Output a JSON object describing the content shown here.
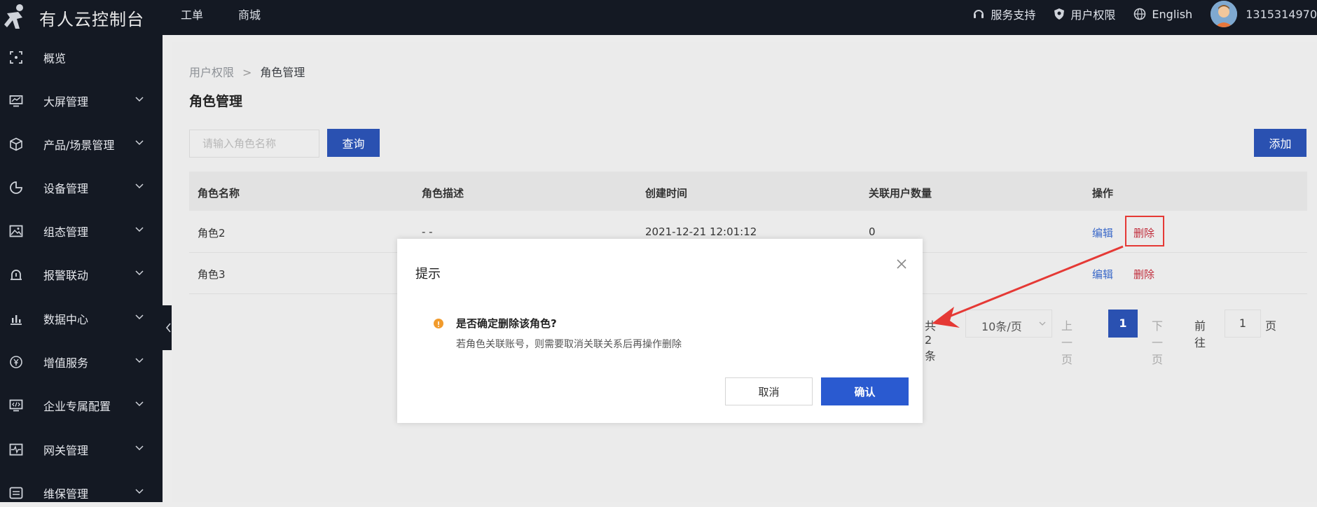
{
  "header": {
    "logo_text": "有人云控制台",
    "nav": [
      "工单",
      "商城"
    ],
    "service": "服务支持",
    "permission": "用户权限",
    "language": "English",
    "user_id": "1315314970"
  },
  "sidebar": {
    "items": [
      {
        "label": "概览",
        "icon": "overview-icon"
      },
      {
        "label": "大屏管理",
        "icon": "screen-icon"
      },
      {
        "label": "产品/场景管理",
        "icon": "cube-icon"
      },
      {
        "label": "设备管理",
        "icon": "pie-icon"
      },
      {
        "label": "组态管理",
        "icon": "image-icon"
      },
      {
        "label": "报警联动",
        "icon": "alarm-icon"
      },
      {
        "label": "数据中心",
        "icon": "bar-icon"
      },
      {
        "label": "增值服务",
        "icon": "yen-icon"
      },
      {
        "label": "企业专属配置",
        "icon": "code-screen-icon"
      },
      {
        "label": "网关管理",
        "icon": "pulse-icon"
      },
      {
        "label": "维保管理",
        "icon": "list-icon"
      }
    ]
  },
  "breadcrumb": {
    "parent": "用户权限",
    "sep": ">",
    "current": "角色管理"
  },
  "page_title": "角色管理",
  "search": {
    "placeholder": "请输入角色名称",
    "button": "查询"
  },
  "add_button": "添加",
  "table": {
    "columns": [
      "角色名称",
      "角色描述",
      "创建时间",
      "关联用户数量",
      "操作"
    ],
    "rows": [
      {
        "name": "角色2",
        "desc": "- -",
        "created": "2021-12-21 12:01:12",
        "users": "0",
        "edit": "编辑",
        "delete": "删除"
      },
      {
        "name": "角色3",
        "edit": "编辑",
        "delete": "删除"
      }
    ]
  },
  "pager": {
    "total": "共 2 条",
    "size": "10条/页",
    "prev": "上一页",
    "page": "1",
    "next": "下一页",
    "goto": "前往",
    "goto_value": "1",
    "page_unit": "页"
  },
  "dialog": {
    "title": "提示",
    "heading": "是否确定删除该角色?",
    "message": "若角色关联账号，则需要取消关联关系后再操作删除",
    "cancel": "取消",
    "confirm": "确认"
  },
  "colors": {
    "primary": "#2a51b1",
    "danger": "#c02b3a",
    "warning": "#f19b2c",
    "annotation": "#e53935"
  }
}
